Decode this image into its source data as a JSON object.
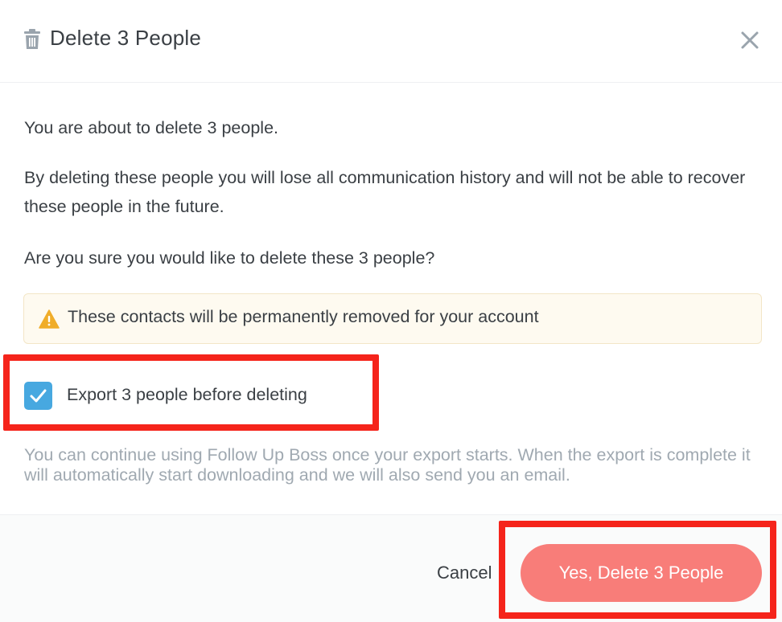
{
  "header": {
    "title": "Delete 3 People",
    "icon": "trash-icon",
    "close_icon": "close-icon"
  },
  "body": {
    "intro": "You are about to delete 3 people.",
    "consequence": "By deleting these people you will lose all communication history and will not be able to recover these people in the future.",
    "question": "Are you sure you would like to delete these 3 people?",
    "warning": {
      "icon": "warning-icon",
      "text": "These contacts will be permanently removed for your account"
    },
    "export_option": {
      "checked": true,
      "label": "Export 3 people before deleting"
    },
    "export_note": "You can continue using Follow Up Boss once your export starts. When the export is complete it will automatically start downloading and we will also send you an email."
  },
  "footer": {
    "cancel_label": "Cancel",
    "confirm_label": "Yes, Delete 3 People"
  },
  "colors": {
    "accent_blue": "#47a8e0",
    "danger": "#f87d79",
    "highlight": "#f5241b",
    "warning_bg": "#fefaf0",
    "warning_icon": "#f0ad2a"
  }
}
